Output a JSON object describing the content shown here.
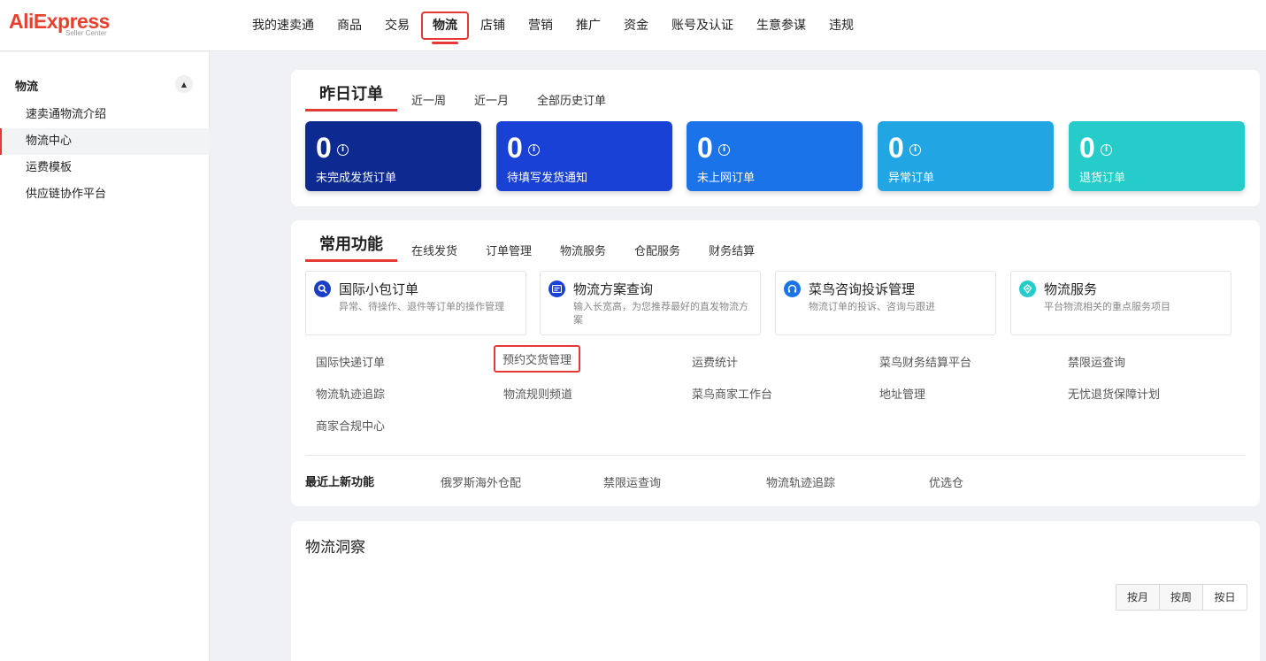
{
  "brand": {
    "name": "AliExpress",
    "sub": "Seller Center"
  },
  "top_nav": [
    {
      "label": "我的速卖通"
    },
    {
      "label": "商品"
    },
    {
      "label": "交易"
    },
    {
      "label": "物流",
      "active": true
    },
    {
      "label": "店铺"
    },
    {
      "label": "营销"
    },
    {
      "label": "推广"
    },
    {
      "label": "资金"
    },
    {
      "label": "账号及认证"
    },
    {
      "label": "生意参谋"
    },
    {
      "label": "违规"
    }
  ],
  "sidebar": {
    "title": "物流",
    "items": [
      {
        "label": "速卖通物流介绍"
      },
      {
        "label": "物流中心",
        "active": true
      },
      {
        "label": "运费模板"
      },
      {
        "label": "供应链协作平台"
      }
    ]
  },
  "orders": {
    "tabs": [
      "昨日订单",
      "近一周",
      "近一月",
      "全部历史订单"
    ],
    "stats": [
      {
        "value": "0",
        "label": "未完成发货订单",
        "color": "#0c2a8f"
      },
      {
        "value": "0",
        "label": "待填写发货通知",
        "color": "#1941d6"
      },
      {
        "value": "0",
        "label": "未上网订单",
        "color": "#1a73e8"
      },
      {
        "value": "0",
        "label": "异常订单",
        "color": "#22a6e3"
      },
      {
        "value": "0",
        "label": "退货订单",
        "color": "#25ccc9"
      }
    ]
  },
  "functions": {
    "tabs": [
      "常用功能",
      "在线发货",
      "订单管理",
      "物流服务",
      "仓配服务",
      "财务结算"
    ],
    "features": [
      {
        "title": "国际小包订单",
        "desc": "异常、待操作、退件等订单的操作管理",
        "icon": "search-icon",
        "color": "#1a3ec5"
      },
      {
        "title": "物流方案查询",
        "desc": "输入长宽高，为您推荐最好的直发物流方案",
        "icon": "document-icon",
        "color": "#1941d6"
      },
      {
        "title": "菜鸟咨询投诉管理",
        "desc": "物流订单的投诉、咨询与跟进",
        "icon": "headset-icon",
        "color": "#1a73e8"
      },
      {
        "title": "物流服务",
        "desc": "平台物流相关的重点服务项目",
        "icon": "service-icon",
        "color": "#25ccc9"
      }
    ],
    "links": [
      [
        "国际快递订单",
        "预约交货管理",
        "运费统计",
        "菜鸟财务结算平台",
        "禁限运查询"
      ],
      [
        "物流轨迹追踪",
        "物流规则频道",
        "菜鸟商家工作台",
        "地址管理",
        "无忧退货保障计划"
      ],
      [
        "商家合规中心"
      ]
    ],
    "recent_label": "最近上新功能",
    "recent": [
      "俄罗斯海外仓配",
      "禁限运查询",
      "物流轨迹追踪",
      "优选仓"
    ]
  },
  "insight": {
    "title": "物流洞察",
    "periods": [
      "按月",
      "按周",
      "按日"
    ]
  }
}
